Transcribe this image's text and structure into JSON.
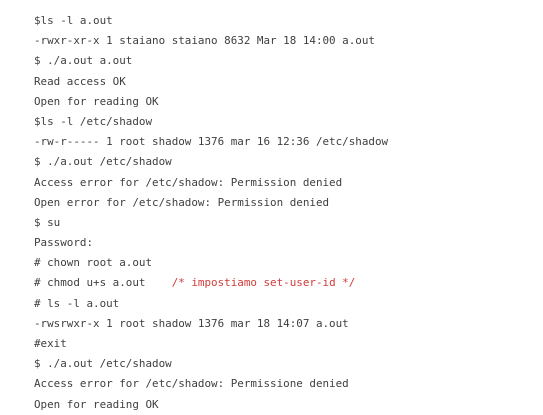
{
  "colors": {
    "text": "#3f3f3f",
    "comment": "#d23b3b",
    "background": "#ffffff"
  },
  "lines": [
    {
      "text": "$ls -l a.out"
    },
    {
      "text": "-rwxr-xr-x 1 staiano staiano 8632 Mar 18 14:00 a.out"
    },
    {
      "text": "$ ./a.out a.out"
    },
    {
      "text": "Read access OK"
    },
    {
      "text": "Open for reading OK"
    },
    {
      "text": "$ls -l /etc/shadow"
    },
    {
      "text": "-rw-r----- 1 root shadow 1376 mar 16 12:36 /etc/shadow"
    },
    {
      "text": "$ ./a.out /etc/shadow"
    },
    {
      "text": "Access error for /etc/shadow: Permission denied"
    },
    {
      "text": "Open error for /etc/shadow: Permission denied"
    },
    {
      "text": "$ su"
    },
    {
      "text": "Password:"
    },
    {
      "text": "# chown root a.out"
    },
    {
      "text": "# chmod u+s a.out    ",
      "comment": "/* impostiamo set-user-id */"
    },
    {
      "text": "# ls -l a.out"
    },
    {
      "text": "-rwsrwxr-x 1 root shadow 1376 mar 18 14:07 a.out"
    },
    {
      "text": "#exit"
    },
    {
      "text": "$ ./a.out /etc/shadow"
    },
    {
      "text": "Access error for /etc/shadow: Permissione denied"
    },
    {
      "text": "Open for reading OK"
    }
  ]
}
